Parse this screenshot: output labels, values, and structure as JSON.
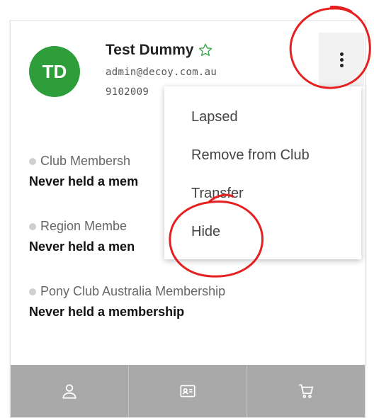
{
  "contact": {
    "initials": "TD",
    "name": "Test Dummy",
    "email": "admin@decoy.com.au",
    "phone": "9102009"
  },
  "memberships": [
    {
      "title": "Club Membersh",
      "status": "Never held a mem"
    },
    {
      "title": "Region Membe",
      "status": "Never held a men"
    },
    {
      "title": "Pony Club Australia Membership",
      "status": "Never held a membership"
    }
  ],
  "menu": {
    "items": [
      "Lapsed",
      "Remove from Club",
      "Transfer",
      "Hide"
    ]
  },
  "bottom_actions": [
    {
      "icon": "user-icon"
    },
    {
      "icon": "id-card-icon"
    },
    {
      "icon": "cart-icon"
    }
  ],
  "colors": {
    "avatar_bg": "#2e9e3a",
    "star": "#3aa64a",
    "annotation": "#e62020",
    "bottom_bar": "#a9a9a9"
  }
}
